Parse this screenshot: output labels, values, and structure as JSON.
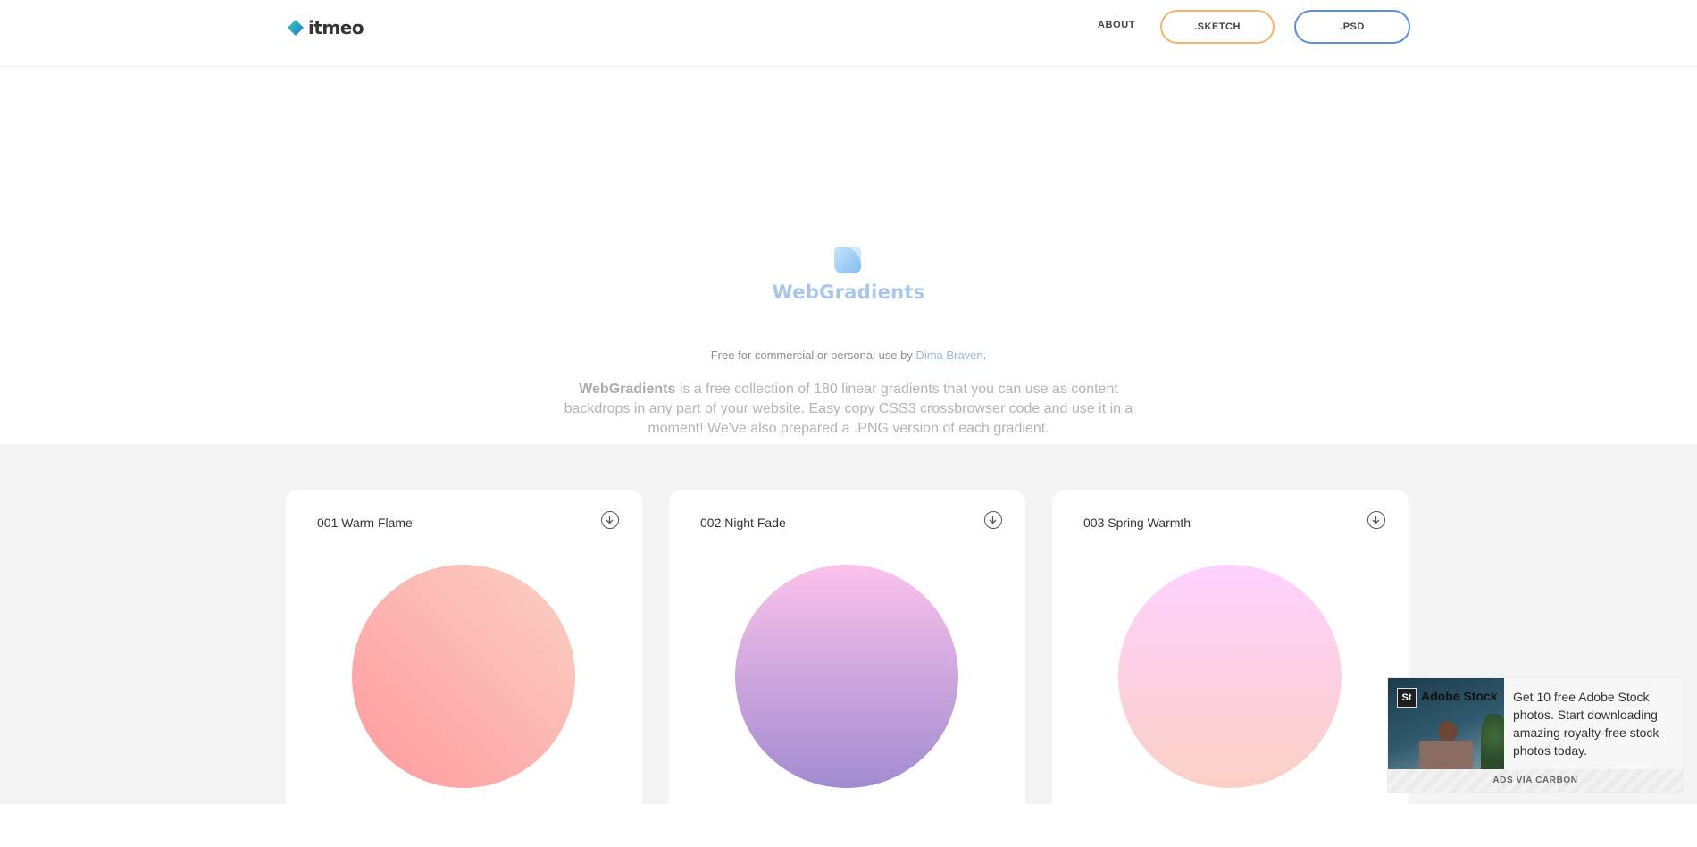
{
  "header": {
    "logo_text": "itmeo",
    "nav": {
      "about_label": "ABOUT",
      "sketch_label": ".SKETCH",
      "psd_label": ".PSD"
    }
  },
  "hero": {
    "title": "WebGradients",
    "credit_prefix": "Free for commercial or personal use by ",
    "credit_author": "Dima Braven",
    "credit_suffix": ".",
    "description_strong": "WebGradients",
    "description_rest": " is a free collection of 180 linear gradients that you can use as content backdrops in any part of your website. Easy copy CSS3 crossbrowser code and use it in a moment! We've also prepared a .PNG version of each gradient."
  },
  "gradients": [
    {
      "title": "001 Warm Flame",
      "colors": [
        "#ff9a9e",
        "#fad0c4"
      ]
    },
    {
      "title": "002 Night Fade",
      "colors": [
        "#a18cd1",
        "#fbc2eb"
      ]
    },
    {
      "title": "003 Spring Warmth",
      "colors": [
        "#fad0c4",
        "#ffd1ff"
      ]
    }
  ],
  "ad": {
    "brand": "Adobe Stock",
    "badge": "St",
    "text": "Get 10 free Adobe Stock photos. Start downloading amazing royalty-free stock photos today.",
    "footer": "ADS VIA CARBON"
  },
  "colors": {
    "accent_orange": "#f5b46a",
    "accent_blue": "#5d8ee3",
    "title_blue": "#a8c6ec",
    "section_gray": "#f4f4f4"
  },
  "icons": [
    "logo-diamond-icon",
    "webgradients-logo-icon",
    "download-icon"
  ]
}
